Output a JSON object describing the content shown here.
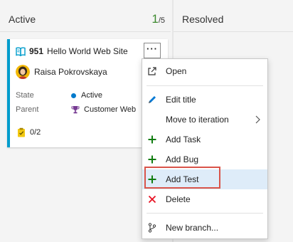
{
  "columns": {
    "active": {
      "title": "Active",
      "count_current": "1",
      "count_limit": "/5"
    },
    "resolved": {
      "title": "Resolved"
    }
  },
  "card": {
    "id": "951",
    "title": "Hello World Web Site",
    "more_label": "···",
    "assignee": "Raisa Pokrovskaya",
    "fields": {
      "state_label": "State",
      "state_value": "Active",
      "parent_label": "Parent",
      "parent_value": "Customer Web"
    },
    "tasks": "0/2",
    "accent_color": "#009ccc",
    "state_color": "#007acc",
    "icon": "book-icon"
  },
  "menu": {
    "items": [
      {
        "label": "Open",
        "icon": "open-icon"
      },
      {
        "label": "Edit title",
        "icon": "pencil-icon"
      },
      {
        "label": "Move to iteration",
        "icon": "chevron-right-icon"
      },
      {
        "label": "Add Task",
        "icon": "plus-icon"
      },
      {
        "label": "Add Bug",
        "icon": "plus-icon"
      },
      {
        "label": "Add Test",
        "icon": "plus-icon",
        "highlighted": true
      },
      {
        "label": "Delete",
        "icon": "x-icon"
      },
      {
        "label": "New branch...",
        "icon": "branch-icon"
      }
    ],
    "highlight_color": "#deecf9",
    "outline_color": "#d9544a"
  }
}
